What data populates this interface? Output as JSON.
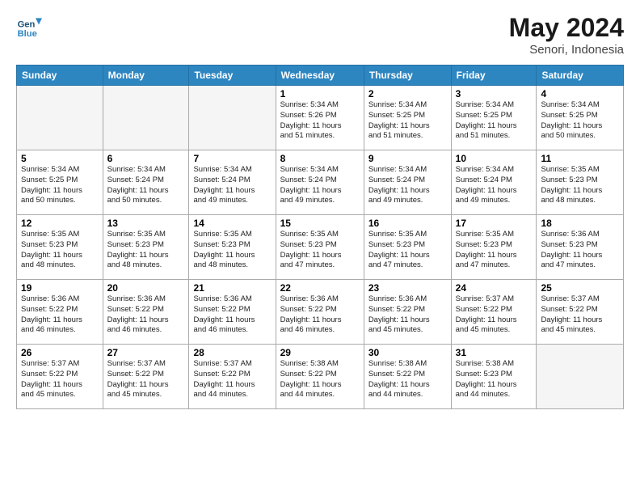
{
  "header": {
    "logo_line1": "General",
    "logo_line2": "Blue",
    "title": "May 2024",
    "subtitle": "Senori, Indonesia"
  },
  "days_of_week": [
    "Sunday",
    "Monday",
    "Tuesday",
    "Wednesday",
    "Thursday",
    "Friday",
    "Saturday"
  ],
  "weeks": [
    [
      {
        "day": "",
        "info": ""
      },
      {
        "day": "",
        "info": ""
      },
      {
        "day": "",
        "info": ""
      },
      {
        "day": "1",
        "info": "Sunrise: 5:34 AM\nSunset: 5:26 PM\nDaylight: 11 hours\nand 51 minutes."
      },
      {
        "day": "2",
        "info": "Sunrise: 5:34 AM\nSunset: 5:25 PM\nDaylight: 11 hours\nand 51 minutes."
      },
      {
        "day": "3",
        "info": "Sunrise: 5:34 AM\nSunset: 5:25 PM\nDaylight: 11 hours\nand 51 minutes."
      },
      {
        "day": "4",
        "info": "Sunrise: 5:34 AM\nSunset: 5:25 PM\nDaylight: 11 hours\nand 50 minutes."
      }
    ],
    [
      {
        "day": "5",
        "info": "Sunrise: 5:34 AM\nSunset: 5:25 PM\nDaylight: 11 hours\nand 50 minutes."
      },
      {
        "day": "6",
        "info": "Sunrise: 5:34 AM\nSunset: 5:24 PM\nDaylight: 11 hours\nand 50 minutes."
      },
      {
        "day": "7",
        "info": "Sunrise: 5:34 AM\nSunset: 5:24 PM\nDaylight: 11 hours\nand 49 minutes."
      },
      {
        "day": "8",
        "info": "Sunrise: 5:34 AM\nSunset: 5:24 PM\nDaylight: 11 hours\nand 49 minutes."
      },
      {
        "day": "9",
        "info": "Sunrise: 5:34 AM\nSunset: 5:24 PM\nDaylight: 11 hours\nand 49 minutes."
      },
      {
        "day": "10",
        "info": "Sunrise: 5:34 AM\nSunset: 5:24 PM\nDaylight: 11 hours\nand 49 minutes."
      },
      {
        "day": "11",
        "info": "Sunrise: 5:35 AM\nSunset: 5:23 PM\nDaylight: 11 hours\nand 48 minutes."
      }
    ],
    [
      {
        "day": "12",
        "info": "Sunrise: 5:35 AM\nSunset: 5:23 PM\nDaylight: 11 hours\nand 48 minutes."
      },
      {
        "day": "13",
        "info": "Sunrise: 5:35 AM\nSunset: 5:23 PM\nDaylight: 11 hours\nand 48 minutes."
      },
      {
        "day": "14",
        "info": "Sunrise: 5:35 AM\nSunset: 5:23 PM\nDaylight: 11 hours\nand 48 minutes."
      },
      {
        "day": "15",
        "info": "Sunrise: 5:35 AM\nSunset: 5:23 PM\nDaylight: 11 hours\nand 47 minutes."
      },
      {
        "day": "16",
        "info": "Sunrise: 5:35 AM\nSunset: 5:23 PM\nDaylight: 11 hours\nand 47 minutes."
      },
      {
        "day": "17",
        "info": "Sunrise: 5:35 AM\nSunset: 5:23 PM\nDaylight: 11 hours\nand 47 minutes."
      },
      {
        "day": "18",
        "info": "Sunrise: 5:36 AM\nSunset: 5:23 PM\nDaylight: 11 hours\nand 47 minutes."
      }
    ],
    [
      {
        "day": "19",
        "info": "Sunrise: 5:36 AM\nSunset: 5:22 PM\nDaylight: 11 hours\nand 46 minutes."
      },
      {
        "day": "20",
        "info": "Sunrise: 5:36 AM\nSunset: 5:22 PM\nDaylight: 11 hours\nand 46 minutes."
      },
      {
        "day": "21",
        "info": "Sunrise: 5:36 AM\nSunset: 5:22 PM\nDaylight: 11 hours\nand 46 minutes."
      },
      {
        "day": "22",
        "info": "Sunrise: 5:36 AM\nSunset: 5:22 PM\nDaylight: 11 hours\nand 46 minutes."
      },
      {
        "day": "23",
        "info": "Sunrise: 5:36 AM\nSunset: 5:22 PM\nDaylight: 11 hours\nand 45 minutes."
      },
      {
        "day": "24",
        "info": "Sunrise: 5:37 AM\nSunset: 5:22 PM\nDaylight: 11 hours\nand 45 minutes."
      },
      {
        "day": "25",
        "info": "Sunrise: 5:37 AM\nSunset: 5:22 PM\nDaylight: 11 hours\nand 45 minutes."
      }
    ],
    [
      {
        "day": "26",
        "info": "Sunrise: 5:37 AM\nSunset: 5:22 PM\nDaylight: 11 hours\nand 45 minutes."
      },
      {
        "day": "27",
        "info": "Sunrise: 5:37 AM\nSunset: 5:22 PM\nDaylight: 11 hours\nand 45 minutes."
      },
      {
        "day": "28",
        "info": "Sunrise: 5:37 AM\nSunset: 5:22 PM\nDaylight: 11 hours\nand 44 minutes."
      },
      {
        "day": "29",
        "info": "Sunrise: 5:38 AM\nSunset: 5:22 PM\nDaylight: 11 hours\nand 44 minutes."
      },
      {
        "day": "30",
        "info": "Sunrise: 5:38 AM\nSunset: 5:22 PM\nDaylight: 11 hours\nand 44 minutes."
      },
      {
        "day": "31",
        "info": "Sunrise: 5:38 AM\nSunset: 5:23 PM\nDaylight: 11 hours\nand 44 minutes."
      },
      {
        "day": "",
        "info": ""
      }
    ]
  ]
}
